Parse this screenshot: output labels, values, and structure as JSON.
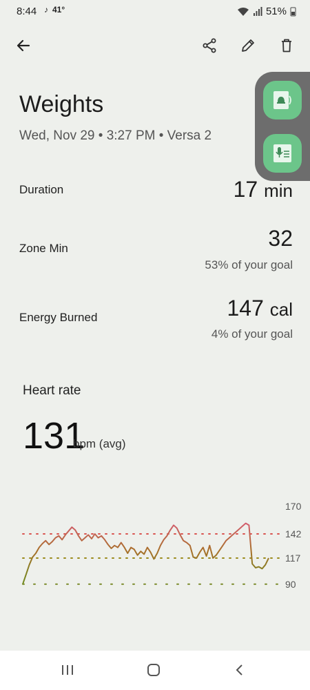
{
  "status_bar": {
    "time": "8:44",
    "temperature": "41°",
    "battery": "51%"
  },
  "activity": {
    "title": "Weights",
    "subtitle": "Wed, Nov 29 • 3:27 PM • Versa 2"
  },
  "metrics": {
    "duration": {
      "label": "Duration",
      "value": "17",
      "unit": "min"
    },
    "zone_min": {
      "label": "Zone Min",
      "value": "32",
      "sub": "53% of your goal"
    },
    "energy": {
      "label": "Energy Burned",
      "value": "147",
      "unit": "cal",
      "sub": "4% of your goal"
    }
  },
  "heart_rate": {
    "title": "Heart rate",
    "value": "131",
    "unit": "bpm (avg)"
  },
  "chart_data": {
    "type": "line",
    "ylim": [
      90,
      170
    ],
    "yticks": [
      "170",
      "142",
      "117",
      "90"
    ],
    "reference_lines": [
      {
        "value": 142,
        "color": "#d9534f"
      },
      {
        "value": 117,
        "color": "#9a8a1a"
      },
      {
        "value": 90,
        "color": "#7a8a2a"
      }
    ],
    "series": [
      {
        "values": [
          90,
          100,
          110,
          118,
          122,
          128,
          132,
          135,
          131,
          134,
          138,
          140,
          136,
          141,
          145,
          149,
          146,
          140,
          135,
          138,
          141,
          137,
          142,
          138,
          140,
          136,
          131,
          127,
          130,
          128,
          133,
          128,
          122,
          128,
          126,
          120,
          124,
          121,
          128,
          123,
          116,
          122,
          130,
          136,
          140,
          146,
          151,
          148,
          141,
          135,
          133,
          130,
          118,
          117,
          123,
          128,
          119,
          130,
          117,
          120,
          125,
          130,
          135,
          138,
          141,
          144,
          147,
          150,
          153,
          151,
          111,
          107,
          108,
          106,
          110,
          117
        ]
      }
    ]
  },
  "colors": {
    "accent": "#6cc58a",
    "line_high": "#c9616a",
    "line_low": "#8a8a1a"
  },
  "icons": {
    "back": "arrow-left-icon",
    "share": "share-icon",
    "edit": "pencil-icon",
    "delete": "trash-icon"
  }
}
